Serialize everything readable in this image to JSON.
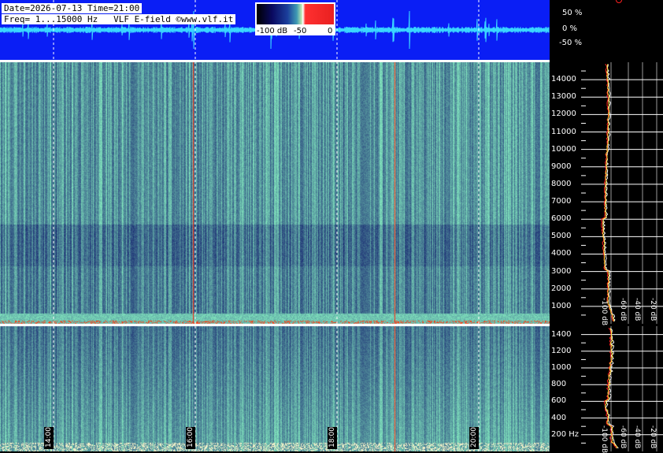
{
  "header": {
    "line1": "Date=2026-07-13 Time=21:00",
    "line2": "Freq= 1...15000 Hz   VLF E-field ©www.vlf.it"
  },
  "colors": {
    "waveform_bg": "#0a1ef5",
    "waveform_trace": "#3ad6ff",
    "spectrogram_base": "#1b2a86",
    "spectrogram_bright": "#7fd6a8",
    "hot": "#ff2a10",
    "profile_red": "#ff2020",
    "profile_yellow": "#ffe040"
  },
  "colorbar": {
    "tick_labels": [
      "-100 dB",
      "-50",
      "0"
    ]
  },
  "chart_data": [
    {
      "type": "line",
      "panel": "waveform",
      "y_tick_labels": [
        "50 %",
        "0 %",
        "-50 %"
      ],
      "ylim": [
        -60,
        60
      ]
    },
    {
      "type": "heatmap",
      "panel": "spectrogram-full",
      "ylim": [
        0,
        15000
      ],
      "y_tick_labels": [
        "14000",
        "13000",
        "12000",
        "11000",
        "10000",
        "9000",
        "8000",
        "7000",
        "6000",
        "5000",
        "4000",
        "3000",
        "2000",
        "1000"
      ],
      "y_ticks": [
        14000,
        13000,
        12000,
        11000,
        10000,
        9000,
        8000,
        7000,
        6000,
        5000,
        4000,
        3000,
        2000,
        1000
      ],
      "profile_x_labels": [
        "-100 dB",
        "-60 dB",
        "-40 dB",
        "-20 dB"
      ]
    },
    {
      "type": "heatmap",
      "panel": "spectrogram-low",
      "ylim": [
        0,
        1500
      ],
      "y_tick_labels": [
        "1400",
        "1200",
        "1000",
        "800",
        "600",
        "400",
        "200 Hz"
      ],
      "y_ticks": [
        1400,
        1200,
        1000,
        800,
        600,
        400,
        200
      ],
      "x_time_labels": [
        "14:00",
        "16:00",
        "18:00",
        "20:00"
      ],
      "profile_x_labels": [
        "-100 dB",
        "-60 dB",
        "-40 dB",
        "-20 dB"
      ]
    }
  ]
}
